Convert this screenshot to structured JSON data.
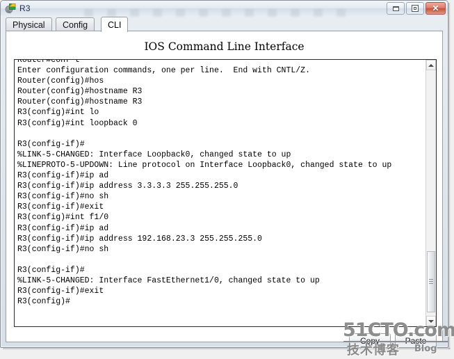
{
  "window": {
    "title": "R3",
    "icon": "router-icon",
    "controls": {
      "minimize_label": "",
      "maximize_label": "",
      "close_label": "✕"
    }
  },
  "tabs": [
    {
      "label": "Physical",
      "active": false
    },
    {
      "label": "Config",
      "active": false
    },
    {
      "label": "CLI",
      "active": true
    }
  ],
  "main": {
    "heading": "IOS Command Line Interface"
  },
  "terminal": {
    "lines": [
      "Router#conf t",
      "Enter configuration commands, one per line.  End with CNTL/Z.",
      "Router(config)#hos",
      "Router(config)#hostname R3",
      "Router(config)#hostname R3",
      "R3(config)#int lo",
      "R3(config)#int loopback 0",
      "",
      "R3(config-if)#",
      "%LINK-5-CHANGED: Interface Loopback0, changed state to up",
      "%LINEPROTO-5-UPDOWN: Line protocol on Interface Loopback0, changed state to up",
      "R3(config-if)#ip ad",
      "R3(config-if)#ip address 3.3.3.3 255.255.255.0",
      "R3(config-if)#no sh",
      "R3(config-if)#exit",
      "R3(config)#int f1/0",
      "R3(config-if)#ip ad",
      "R3(config-if)#ip address 192.168.23.3 255.255.255.0",
      "R3(config-if)#no sh",
      "",
      "R3(config-if)#",
      "%LINK-5-CHANGED: Interface FastEthernet1/0, changed state to up",
      "R3(config-if)#exit",
      "R3(config)#"
    ]
  },
  "scrollbar": {
    "up_arrow": "scroll-up-icon",
    "down_arrow": "scroll-down-icon"
  },
  "buttons": {
    "copy_label": "Copy",
    "paste_label": "Paste"
  },
  "watermark": {
    "main": "51CTO.com",
    "chinese": "技术博客",
    "blog": "Blog"
  }
}
